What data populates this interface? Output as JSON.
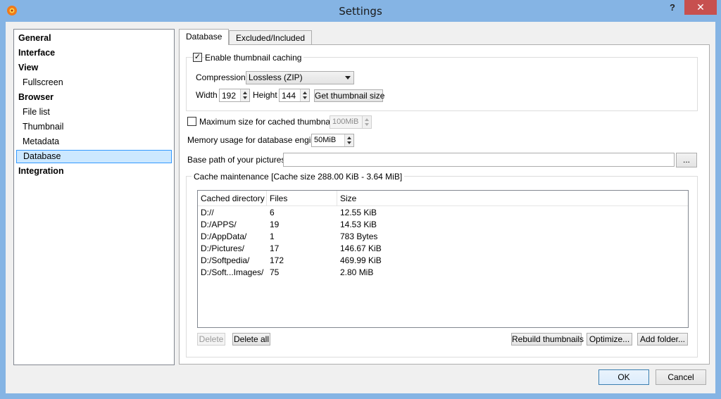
{
  "window": {
    "title": "Settings",
    "help_label": "?",
    "close_label": "✕"
  },
  "sidebar": {
    "items": [
      {
        "label": "General"
      },
      {
        "label": "Interface"
      },
      {
        "label": "View"
      },
      {
        "label": "Fullscreen"
      },
      {
        "label": "Browser"
      },
      {
        "label": "File list"
      },
      {
        "label": "Thumbnail"
      },
      {
        "label": "Metadata"
      },
      {
        "label": "Database"
      },
      {
        "label": "Integration"
      }
    ],
    "selected": "Database"
  },
  "tabs": [
    {
      "label": "Database",
      "active": true
    },
    {
      "label": "Excluded/Included",
      "active": false
    }
  ],
  "caching": {
    "enable_label": "Enable thumbnail caching",
    "enable_checked": true,
    "compression_label": "Compression:",
    "compression_value": "Lossless (ZIP)",
    "width_label": "Width",
    "width_value": "192",
    "height_label": "Height",
    "height_value": "144",
    "get_size_label": "Get thumbnail size"
  },
  "max_size": {
    "label": "Maximum size for cached thumbnails",
    "checked": false,
    "value": "100MiB"
  },
  "memory": {
    "label": "Memory usage for database engine",
    "value": "50MiB"
  },
  "base_path": {
    "label": "Base path of your pictures",
    "value": "",
    "browse_label": "..."
  },
  "cache_maintenance": {
    "label": "Cache maintenance [Cache size 288.00 KiB - 3.64 MiB]",
    "columns": [
      "Cached directory",
      "Files",
      "Size"
    ],
    "rows": [
      {
        "dir": "D://",
        "files": "6",
        "size": "12.55 KiB"
      },
      {
        "dir": "D:/APPS/",
        "files": "19",
        "size": "14.53 KiB"
      },
      {
        "dir": "D:/AppData/",
        "files": "1",
        "size": "783 Bytes"
      },
      {
        "dir": "D:/Pictures/",
        "files": "17",
        "size": "146.67 KiB"
      },
      {
        "dir": "D:/Softpedia/",
        "files": "172",
        "size": "469.99 KiB"
      },
      {
        "dir": "D:/Soft...Images/",
        "files": "75",
        "size": "2.80 MiB"
      }
    ],
    "delete_label": "Delete",
    "delete_all_label": "Delete all",
    "rebuild_label": "Rebuild thumbnails",
    "optimize_label": "Optimize...",
    "add_folder_label": "Add folder..."
  },
  "dialog": {
    "ok_label": "OK",
    "cancel_label": "Cancel"
  },
  "colors": {
    "accent": "#3399ff",
    "selection": "#cce8ff",
    "titlebar": "#85b4e4",
    "close": "#c7504f"
  }
}
